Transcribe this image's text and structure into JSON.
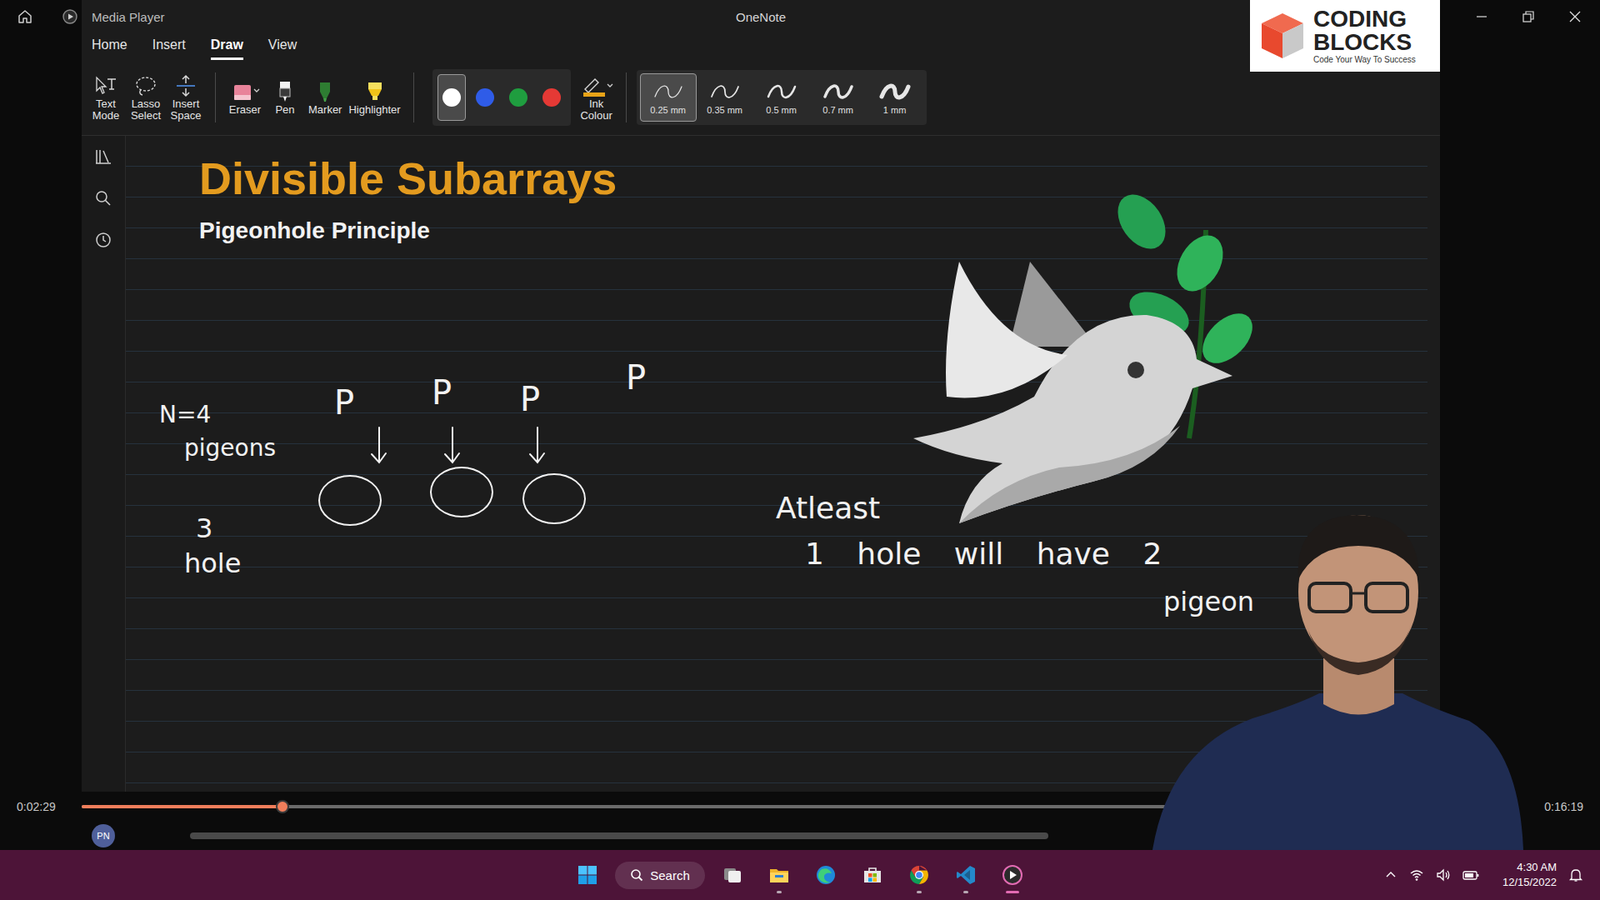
{
  "player": {
    "title": "Media Player",
    "elapsed": "0:02:29",
    "total": "0:16:19",
    "level": 0.14
  },
  "app": {
    "title": "OneNote",
    "tabs": [
      {
        "label": "Home",
        "selected": false
      },
      {
        "label": "Insert",
        "selected": false
      },
      {
        "label": "Draw",
        "selected": true
      },
      {
        "label": "View",
        "selected": false
      }
    ],
    "tools": [
      {
        "label": "Text Mode",
        "kind": "text"
      },
      {
        "label": "Lasso Select",
        "kind": "lasso"
      },
      {
        "label": "Insert Space",
        "kind": "space"
      },
      {
        "label": "Eraser",
        "kind": "eraser"
      },
      {
        "label": "Pen",
        "kind": "pen"
      },
      {
        "label": "Marker",
        "kind": "marker"
      },
      {
        "label": "Highlighter",
        "kind": "highlighter"
      }
    ],
    "colors": [
      {
        "color": "#ffffff",
        "selected": true
      },
      {
        "color": "#2f5ce8",
        "selected": false
      },
      {
        "color": "#1f9d3f",
        "selected": false
      },
      {
        "color": "#e53935",
        "selected": false
      }
    ],
    "ink": {
      "label": "Ink Colour",
      "color": "#e8a317"
    },
    "widths": [
      {
        "label": "0.25 mm",
        "selected": true
      },
      {
        "label": "0.35 mm",
        "selected": false
      },
      {
        "label": "0.5 mm",
        "selected": false
      },
      {
        "label": "0.7 mm",
        "selected": false
      },
      {
        "label": "1 mm",
        "selected": false
      }
    ],
    "avatar": "PN"
  },
  "logo": {
    "line1": "CODING",
    "line2": "BLOCKS",
    "tagline": "Code Your Way To Success"
  },
  "page": {
    "title": "Divisible Subarrays",
    "subtitle": "Pigeonhole Principle",
    "pigeonCount": "N=4",
    "pigeonLabel": "pigeons",
    "holeCount": "3",
    "holeLabel": "hole",
    "pigeons": [
      {
        "label": "P",
        "placed": true
      },
      {
        "label": "P",
        "placed": true
      },
      {
        "label": "P",
        "placed": true
      },
      {
        "label": "P",
        "placed": false
      }
    ],
    "conclusion": [
      "Atleast",
      "1 hole will have 2",
      "pigeon"
    ]
  },
  "taskbar": {
    "search": "Search",
    "time": "4:30 AM",
    "date": "12/15/2022",
    "apps": [
      {
        "kind": "taskview",
        "running": false,
        "active": false
      },
      {
        "kind": "explorer",
        "running": true,
        "active": false
      },
      {
        "kind": "edge",
        "running": false,
        "active": false
      },
      {
        "kind": "store",
        "running": false,
        "active": false
      },
      {
        "kind": "chrome",
        "running": true,
        "active": false
      },
      {
        "kind": "vscode",
        "running": true,
        "active": false
      },
      {
        "kind": "player",
        "running": true,
        "active": true
      }
    ]
  }
}
